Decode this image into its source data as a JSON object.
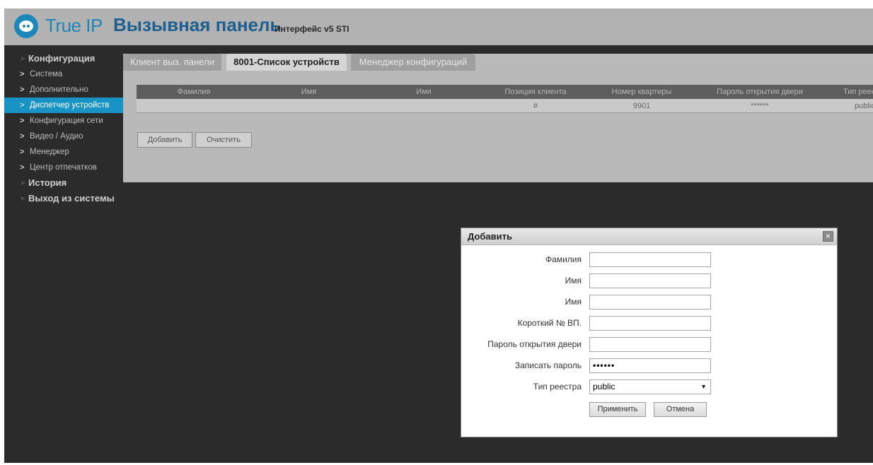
{
  "header": {
    "brand": "True IP",
    "title": "Вызывная панель",
    "subtitle": "Интерфейс v5 STI"
  },
  "sidebar": {
    "config_label": "Конфигурация",
    "items": [
      {
        "label": "Система"
      },
      {
        "label": "Дополнительно"
      },
      {
        "label": "Диспетчер устройств"
      },
      {
        "label": "Конфигурация сети"
      },
      {
        "label": "Видео / Аудио"
      },
      {
        "label": "Менеджер"
      },
      {
        "label": "Центр отпечатков"
      }
    ],
    "history_label": "История",
    "logout_label": "Выход из системы"
  },
  "tabs": [
    {
      "label": "Клиент выз. панели"
    },
    {
      "label": "8001-Список устройств"
    },
    {
      "label": "Менеджер конфигураций"
    }
  ],
  "table": {
    "headers": [
      "Фамилия",
      "Имя",
      "Имя",
      "Позиция клиента",
      "Номер квартиры",
      "Пароль открытия двери",
      "Тип реестра"
    ],
    "rows": [
      [
        "",
        "",
        "",
        "#",
        "9901",
        "******",
        "public"
      ]
    ]
  },
  "main_buttons": {
    "add": "Добавить",
    "clear": "Очистить"
  },
  "dialog": {
    "title": "Добавить",
    "close_glyph": "×",
    "fields": [
      {
        "label": "Фамилия",
        "value": ""
      },
      {
        "label": "Имя",
        "value": ""
      },
      {
        "label": "Имя",
        "value": ""
      },
      {
        "label": "Короткий № ВП.",
        "value": ""
      },
      {
        "label": "Пароль открытия двери",
        "value": ""
      },
      {
        "label": "Записать пароль",
        "value": "••••••"
      }
    ],
    "registry_label": "Тип реестра",
    "registry_value": "public",
    "apply": "Применить",
    "cancel": "Отмена"
  },
  "colors": {
    "accent": "#1893c4",
    "brand": "#1e87b8",
    "title": "#1f5f8f"
  }
}
